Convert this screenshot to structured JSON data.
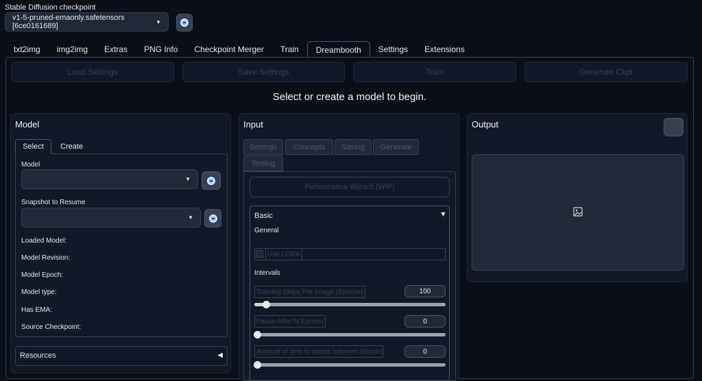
{
  "checkpoint": {
    "label": "Stable Diffusion checkpoint",
    "value": "v1-5-pruned-emaonly.safetensors [6ce0161689]"
  },
  "tabs": [
    "txt2img",
    "img2img",
    "Extras",
    "PNG Info",
    "Checkpoint Merger",
    "Train",
    "Dreambooth",
    "Settings",
    "Extensions"
  ],
  "toolbar": {
    "load_settings": "Load Settings",
    "save_settings": "Save Settings",
    "train": "Train",
    "generate_ckpt": "Generate Ckpt"
  },
  "status_message": "Select or create a model to begin.",
  "model_panel": {
    "title": "Model",
    "tabs": [
      "Select",
      "Create"
    ],
    "model_label": "Model",
    "model_value": "",
    "snapshot_label": "Snapshot to Resume",
    "snapshot_value": "",
    "info": [
      {
        "label": "Loaded Model:",
        "value": ""
      },
      {
        "label": "Model Revision:",
        "value": ""
      },
      {
        "label": "Model Epoch:",
        "value": ""
      },
      {
        "label": "Model type:",
        "value": ""
      },
      {
        "label": "Has EMA:",
        "value": ""
      },
      {
        "label": "Source Checkpoint:",
        "value": ""
      }
    ],
    "resources": "Resources"
  },
  "input_panel": {
    "title": "Input",
    "tabs": [
      "Settings",
      "Concepts",
      "Saving",
      "Generate",
      "Testing"
    ],
    "performance_wizard": "Performance Wizard (WIP)",
    "basic": {
      "title": "Basic",
      "general": "General",
      "use_lora": "Use LORA",
      "intervals": "Intervals",
      "sliders": [
        {
          "label": "Training Steps Per Image (Epochs)",
          "value": "100",
          "fraction": 0.06
        },
        {
          "label": "Pause After N Epochs",
          "value": "0",
          "fraction": 0
        },
        {
          "label": "Amount of time to pause between Epochs (s)",
          "value": "0",
          "fraction": 0
        }
      ]
    }
  },
  "output_panel": {
    "title": "Output"
  }
}
